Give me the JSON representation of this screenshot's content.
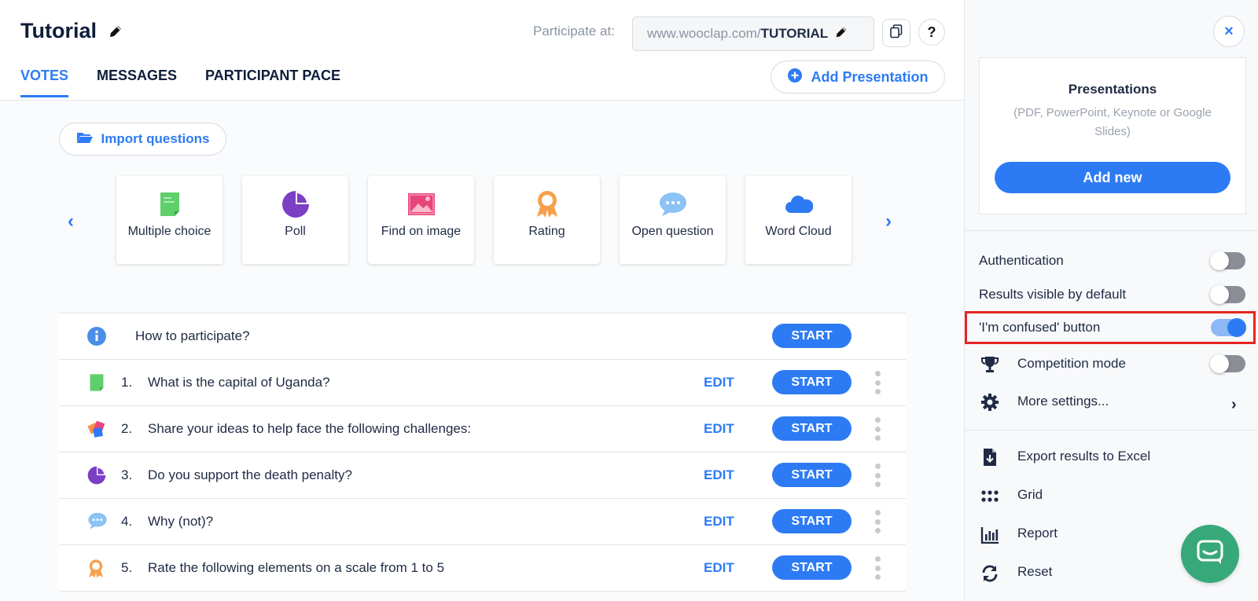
{
  "header": {
    "title": "Tutorial",
    "participate_label": "Participate at:",
    "url_prefix": "www.wooclap.com/",
    "url_code": "TUTORIAL",
    "help_label": "?"
  },
  "tabs": [
    {
      "label": "VOTES",
      "active": true
    },
    {
      "label": "MESSAGES",
      "active": false
    },
    {
      "label": "PARTICIPANT PACE",
      "active": false
    }
  ],
  "add_presentation_label": "Add Presentation",
  "import_label": "Import questions",
  "question_types": [
    {
      "label": "Multiple choice",
      "icon": "multiple-choice-icon"
    },
    {
      "label": "Poll",
      "icon": "poll-icon"
    },
    {
      "label": "Find on image",
      "icon": "image-icon"
    },
    {
      "label": "Rating",
      "icon": "rating-icon"
    },
    {
      "label": "Open question",
      "icon": "speech-bubble-icon"
    },
    {
      "label": "Word Cloud",
      "icon": "cloud-icon"
    }
  ],
  "questions": [
    {
      "number": "",
      "text": "How to participate?",
      "icon": "info-icon",
      "edit": "",
      "start": "START"
    },
    {
      "number": "1.",
      "text": "What is the capital of Uganda?",
      "icon": "multiple-choice-icon",
      "edit": "EDIT",
      "start": "START"
    },
    {
      "number": "2.",
      "text": "Share your ideas to help face the following challenges:",
      "icon": "brainstorm-icon",
      "edit": "EDIT",
      "start": "START"
    },
    {
      "number": "3.",
      "text": "Do you support the death penalty?",
      "icon": "poll-icon",
      "edit": "EDIT",
      "start": "START"
    },
    {
      "number": "4.",
      "text": "Why (not)?",
      "icon": "speech-bubble-icon",
      "edit": "EDIT",
      "start": "START"
    },
    {
      "number": "5.",
      "text": "Rate the following elements on a scale from 1 to 5",
      "icon": "rating-icon",
      "edit": "EDIT",
      "start": "START"
    }
  ],
  "panel": {
    "close_label": "×",
    "presentations_title": "Presentations",
    "presentations_sub": "(PDF, PowerPoint, Keynote or Google Slides)",
    "add_new_label": "Add new",
    "settings": [
      {
        "label": "Authentication",
        "on": false
      },
      {
        "label": "Results visible by default",
        "on": false
      },
      {
        "label": "'I'm confused' button",
        "on": true
      },
      {
        "label": "Competition mode",
        "on": false
      }
    ],
    "more_settings": "More settings...",
    "actions": [
      {
        "label": "Export results to Excel",
        "icon": "export-excel-icon"
      },
      {
        "label": "Grid",
        "icon": "grid-icon"
      },
      {
        "label": "Report",
        "icon": "report-icon"
      },
      {
        "label": "Reset",
        "icon": "reset-icon"
      }
    ]
  },
  "colors": {
    "accent": "#2d7bf4",
    "highlight": "#e52620",
    "chat": "#37a87a"
  }
}
